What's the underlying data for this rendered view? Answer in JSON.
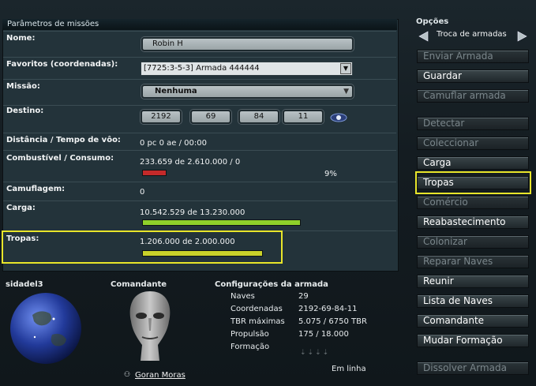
{
  "panel": {
    "title": "Parâmetros de missões"
  },
  "fields": {
    "name_label": "Nome:",
    "name_value": "Robin H",
    "favorites_label": "Favoritos (coordenadas):",
    "favorites_value": "[7725:3-5-3] Armada 444444",
    "mission_label": "Missão:",
    "mission_value": "Nenhuma",
    "destination_label": "Destino:",
    "destination": [
      "2192",
      "69",
      "84",
      "11"
    ],
    "distance_label": "Distância / Tempo de vôo:",
    "distance_value": "0 pc 0 ae / 00:00",
    "fuel_label": "Combustível / Consumo:",
    "fuel_value": "233.659 de 2.610.000 / 0",
    "fuel_percent_text": "9%",
    "fuel_fraction": 0.09,
    "camo_label": "Camuflagem:",
    "camo_value": "0",
    "cargo_label": "Carga:",
    "cargo_value": "10.542.529 de 13.230.000",
    "cargo_fraction": 0.797,
    "troops_label": "Tropas:",
    "troops_value": "1.206.000 de 2.000.000",
    "troops_fraction": 0.603
  },
  "planet": {
    "name": "sidadel3"
  },
  "commander": {
    "title": "Comandante",
    "name": "Goran Moras"
  },
  "fleet_config": {
    "title": "Configurações da armada",
    "rows": [
      {
        "label": "Naves",
        "value": "29"
      },
      {
        "label": "Coordenadas",
        "value": "2192-69-84-11"
      },
      {
        "label": "TBR máximas",
        "value": "5.075 / 6750 TBR"
      },
      {
        "label": "Propulsão",
        "value": "175 / 18.000"
      },
      {
        "label": "Formação",
        "value": ""
      }
    ],
    "status": "Em linha"
  },
  "options": {
    "title": "Opções",
    "selector": "Troca de armadas",
    "buttons": [
      {
        "label": "Enviar Armada",
        "enabled": false
      },
      {
        "label": "Guardar",
        "enabled": true
      },
      {
        "label": "Camuflar armada",
        "enabled": false
      },
      {
        "label": "Detectar",
        "enabled": false
      },
      {
        "label": "Coleccionar",
        "enabled": false
      },
      {
        "label": "Carga",
        "enabled": true
      },
      {
        "label": "Tropas",
        "enabled": true
      },
      {
        "label": "Comércio",
        "enabled": false
      },
      {
        "label": "Reabastecimento",
        "enabled": true
      },
      {
        "label": "Colonizar",
        "enabled": false
      },
      {
        "label": "Reparar Naves",
        "enabled": false
      },
      {
        "label": "Reunir",
        "enabled": true
      },
      {
        "label": "Lista de Naves",
        "enabled": true
      },
      {
        "label": "Comandante",
        "enabled": true
      },
      {
        "label": "Mudar Formação",
        "enabled": true
      },
      {
        "label": "Dissolver Armada",
        "enabled": false
      }
    ]
  },
  "colors": {
    "highlight": "#e8e52a",
    "fuel_bar": "#c42a2a",
    "cargo_bar": "#8fd12a",
    "troops_bar": "#c9d12a"
  }
}
